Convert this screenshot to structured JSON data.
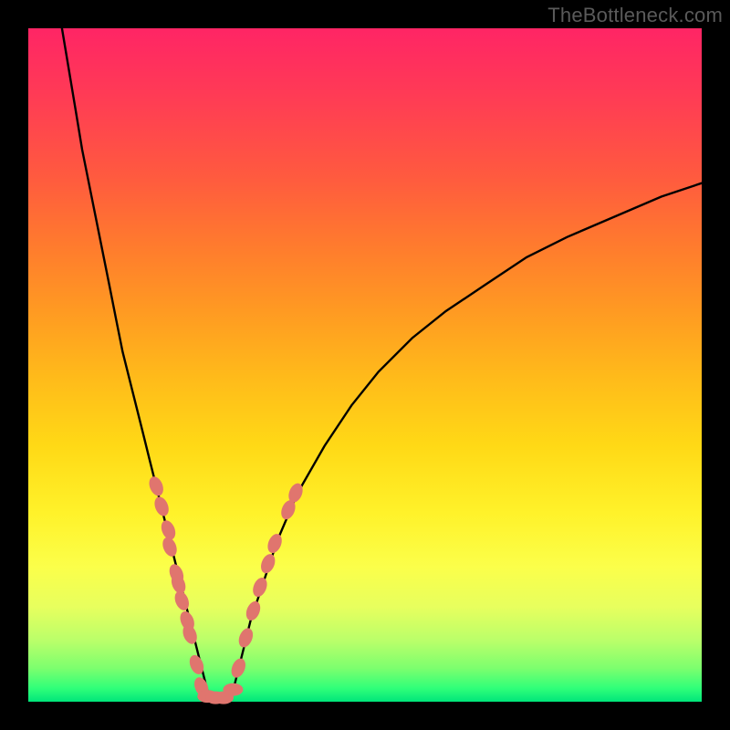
{
  "watermark": "TheBottleneck.com",
  "chart_data": {
    "type": "line",
    "title": "",
    "xlabel": "",
    "ylabel": "",
    "xlim": [
      0,
      100
    ],
    "ylim": [
      0,
      100
    ],
    "grid": false,
    "legend": false,
    "background": "vertical-gradient red→orange→yellow→green",
    "curve_left": {
      "name": "left-branch",
      "color": "#000000",
      "x": [
        5,
        6,
        7,
        8,
        9,
        10,
        11,
        12,
        13,
        14,
        15,
        16,
        17,
        18,
        19,
        20,
        21,
        22,
        23,
        24,
        25,
        26,
        27
      ],
      "y": [
        100,
        94,
        88,
        82,
        77,
        72,
        67,
        62,
        57,
        52,
        48,
        44,
        40,
        36,
        32,
        28,
        24,
        20,
        16,
        12,
        8,
        4,
        0
      ]
    },
    "curve_right": {
      "name": "right-branch",
      "color": "#000000",
      "x": [
        30,
        31,
        32,
        33,
        35,
        37,
        40,
        44,
        48,
        52,
        57,
        62,
        68,
        74,
        80,
        87,
        94,
        100
      ],
      "y": [
        0,
        4,
        8,
        12,
        18,
        24,
        31,
        38,
        44,
        49,
        54,
        58,
        62,
        66,
        69,
        72,
        75,
        77
      ]
    },
    "markers": {
      "name": "highlighted-points",
      "color": "#e0756e",
      "type": "scatter",
      "points": [
        {
          "x": 19.0,
          "y": 32.0
        },
        {
          "x": 19.8,
          "y": 29.0
        },
        {
          "x": 20.8,
          "y": 25.5
        },
        {
          "x": 21.0,
          "y": 23.0
        },
        {
          "x": 22.0,
          "y": 19.0
        },
        {
          "x": 22.3,
          "y": 17.5
        },
        {
          "x": 22.8,
          "y": 15.0
        },
        {
          "x": 23.6,
          "y": 12.0
        },
        {
          "x": 24.0,
          "y": 10.0
        },
        {
          "x": 25.0,
          "y": 5.5
        },
        {
          "x": 25.7,
          "y": 2.2
        },
        {
          "x": 26.6,
          "y": 0.8
        },
        {
          "x": 27.8,
          "y": 0.6
        },
        {
          "x": 29.0,
          "y": 0.6
        },
        {
          "x": 30.4,
          "y": 1.8
        },
        {
          "x": 31.2,
          "y": 5.0
        },
        {
          "x": 32.3,
          "y": 9.5
        },
        {
          "x": 33.4,
          "y": 13.5
        },
        {
          "x": 34.4,
          "y": 17.0
        },
        {
          "x": 35.6,
          "y": 20.5
        },
        {
          "x": 36.6,
          "y": 23.5
        },
        {
          "x": 38.6,
          "y": 28.5
        },
        {
          "x": 39.7,
          "y": 31.0
        }
      ]
    }
  }
}
